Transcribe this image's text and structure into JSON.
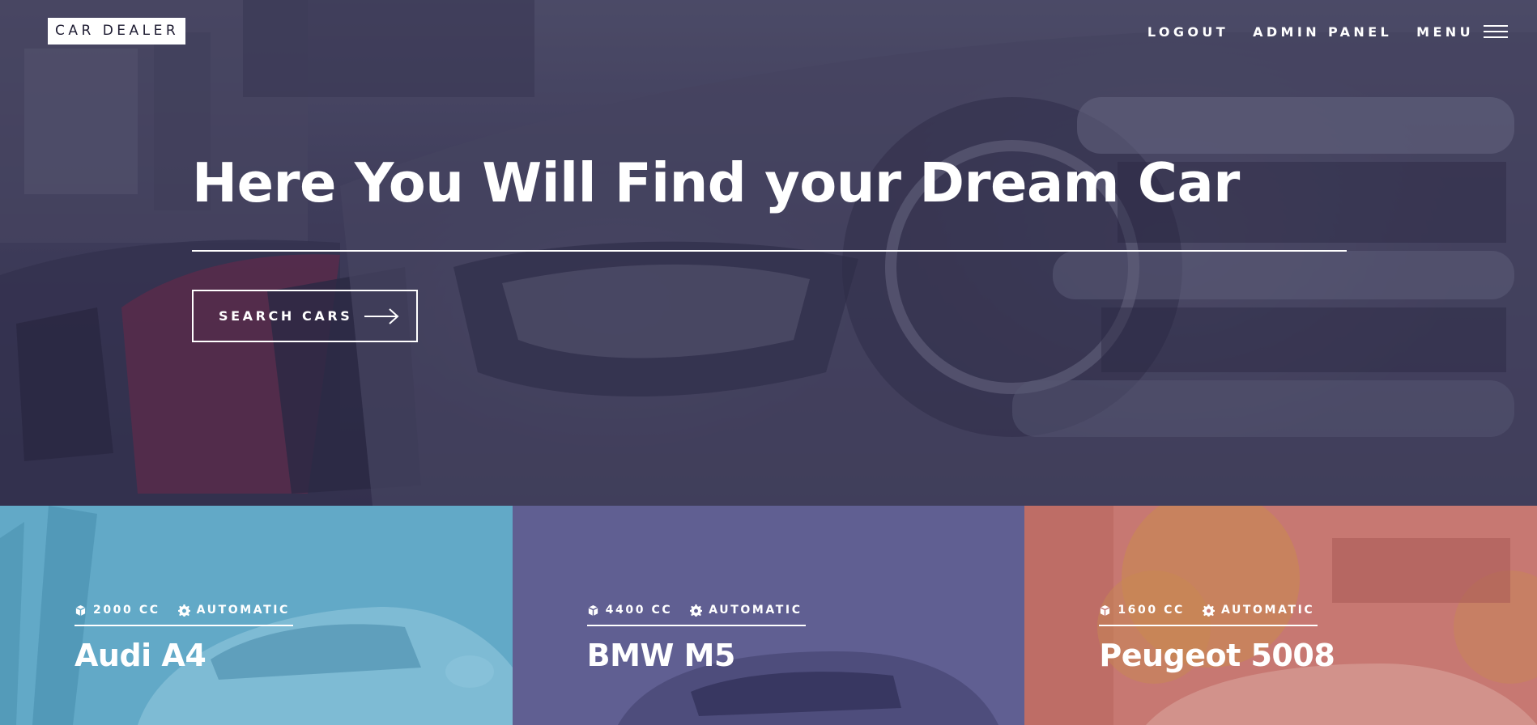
{
  "header": {
    "logo_text": "CAR DEALER",
    "nav": {
      "logout": "LOGOUT",
      "admin_panel": "ADMIN PANEL",
      "menu": "MENU"
    }
  },
  "hero": {
    "title": "Here You Will Find your Dream Car",
    "search_button": "SEARCH CARS"
  },
  "cars": [
    {
      "engine": "2000 CC",
      "transmission": "AUTOMATIC",
      "name": "Audi A4",
      "overlay_color": "#5fa6c6"
    },
    {
      "engine": "4400 CC",
      "transmission": "AUTOMATIC",
      "name": "BMW M5",
      "overlay_color": "#5b5a8e"
    },
    {
      "engine": "1600 CC",
      "transmission": "AUTOMATIC",
      "name": "Peugeot 5008",
      "overlay_color": "#c77872"
    }
  ],
  "icons": {
    "engine": "cube-icon",
    "transmission": "gear-icon",
    "menu": "hamburger-icon",
    "search": "arrow-right-icon"
  }
}
